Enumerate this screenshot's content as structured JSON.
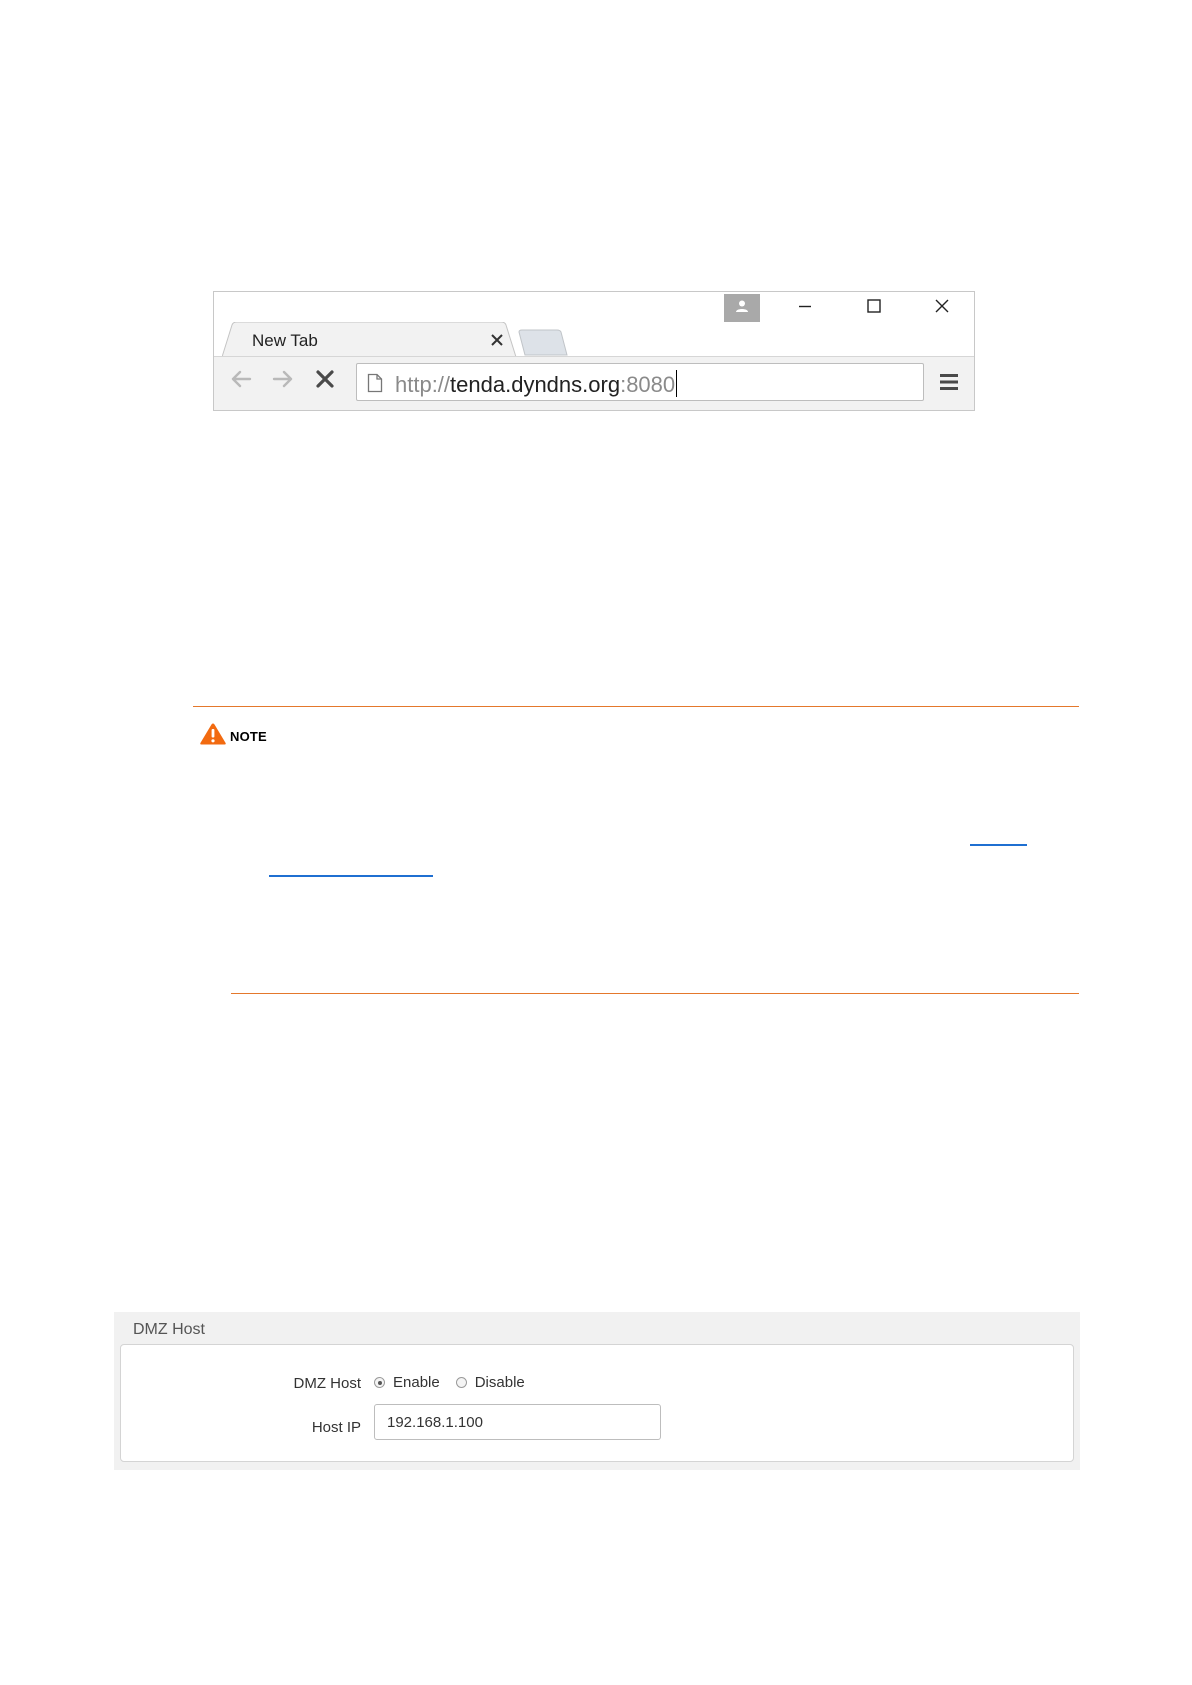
{
  "browser": {
    "tab": {
      "label": "New Tab"
    },
    "address_bar": {
      "scheme": "http://",
      "host": "tenda.dyndns.org",
      "port": ":8080"
    },
    "icons": {
      "profile": "profile-icon",
      "minimize": "minimize-icon",
      "maximize": "maximize-icon",
      "close": "close-icon",
      "back": "back-arrow-icon",
      "forward": "forward-arrow-icon",
      "stop": "stop-icon",
      "page": "page-icon",
      "menu": "hamburger-menu-icon"
    }
  },
  "note": {
    "label": "NOTE",
    "accent_color": "#e4782c",
    "link_color": "#1f6fd1"
  },
  "dmz": {
    "panel_title": "DMZ Host",
    "host_label": "DMZ Host",
    "enable_label": "Enable",
    "disable_label": "Disable",
    "selected": "Enable",
    "ip_label": "Host IP",
    "ip_value": "192.168.1.100"
  }
}
